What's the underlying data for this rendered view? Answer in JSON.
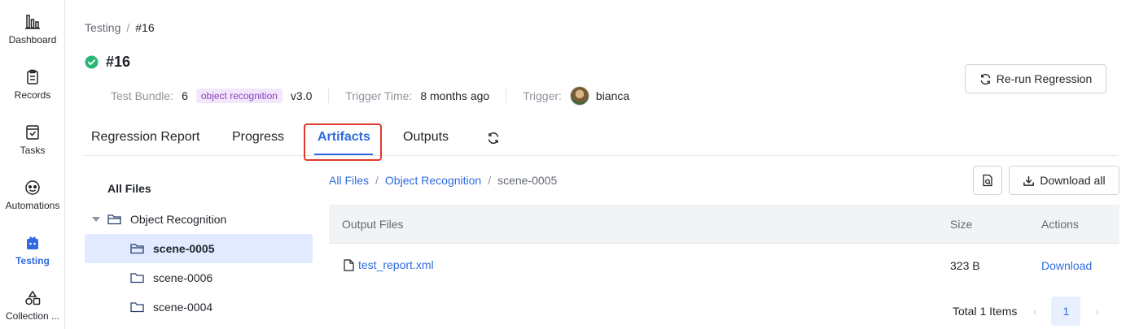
{
  "sidebar": {
    "items": [
      {
        "label": "Dashboard",
        "icon": "bar-chart-icon",
        "active": false
      },
      {
        "label": "Records",
        "icon": "clipboard-icon",
        "active": false
      },
      {
        "label": "Tasks",
        "icon": "task-check-icon",
        "active": false
      },
      {
        "label": "Automations",
        "icon": "robot-icon",
        "active": false
      },
      {
        "label": "Testing",
        "icon": "testing-icon",
        "active": true
      },
      {
        "label": "Collection ...",
        "icon": "collection-icon",
        "active": false
      }
    ]
  },
  "header": {
    "breadcrumb": {
      "parent": "Testing",
      "separator": "/",
      "current": "#16"
    },
    "title": "#16",
    "status": "success",
    "meta": {
      "bundle_label": "Test Bundle:",
      "bundle_value": "6",
      "bundle_tag": "object recognition",
      "bundle_version": "v3.0",
      "trigger_time_label": "Trigger Time:",
      "trigger_time_value": "8 months ago",
      "trigger_label": "Trigger:",
      "trigger_user": "bianca"
    },
    "rerun_label": "Re-run Regression"
  },
  "tabs": [
    {
      "label": "Regression Report",
      "active": false
    },
    {
      "label": "Progress",
      "active": false
    },
    {
      "label": "Artifacts",
      "active": true
    },
    {
      "label": "Outputs",
      "active": false
    }
  ],
  "tree": {
    "root_label": "All Files",
    "folder": "Object Recognition",
    "children": [
      "scene-0005",
      "scene-0006",
      "scene-0004"
    ],
    "selected": "scene-0005"
  },
  "content": {
    "breadcrumb": [
      "All Files",
      "Object Recognition",
      "scene-0005"
    ],
    "download_all_label": "Download all",
    "columns": {
      "name": "Output Files",
      "size": "Size",
      "actions": "Actions"
    },
    "rows": [
      {
        "name": "test_report.xml",
        "size": "323 B",
        "action": "Download"
      }
    ],
    "pagination": {
      "total": "Total 1 Items",
      "current_page": "1"
    }
  },
  "colors": {
    "accent": "#2f6bde",
    "success": "#2bb673",
    "highlight": "#e0392b",
    "tag_bg": "#f3e8fb",
    "tag_fg": "#8a3fbf"
  }
}
